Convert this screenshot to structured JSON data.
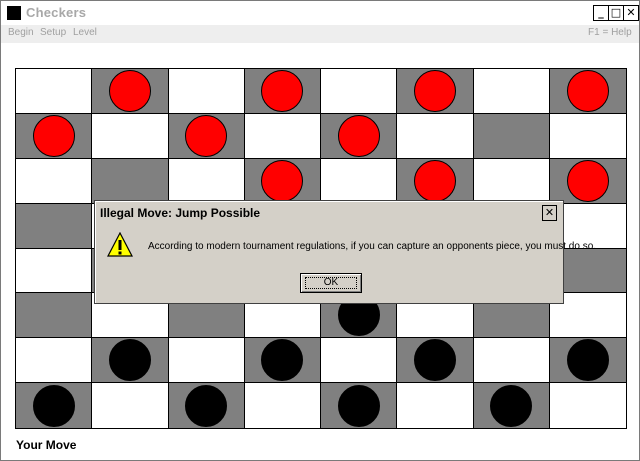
{
  "window": {
    "title": "Checkers",
    "minimize_glyph": "_",
    "maximize_glyph": "□",
    "close_glyph": "✕",
    "icon": "app-icon"
  },
  "menu": {
    "items": [
      "Begin",
      "Setup",
      "Level"
    ],
    "help": "F1 = Help"
  },
  "board": {
    "colors": {
      "light": "#ffffff",
      "dark": "#808080",
      "red": "#ff0000",
      "black": "#000000"
    },
    "rows": [
      [
        "",
        "R",
        "",
        "R",
        "",
        "R",
        "",
        "R"
      ],
      [
        "R",
        "",
        "R",
        "",
        "R",
        "",
        "",
        ""
      ],
      [
        "",
        "",
        "",
        "R",
        "",
        "R",
        "",
        "R"
      ],
      [
        "",
        "",
        "",
        "",
        "",
        "",
        "",
        ""
      ],
      [
        "",
        "",
        "",
        "",
        "",
        "",
        "",
        ""
      ],
      [
        "",
        "",
        "",
        "",
        "B",
        "",
        "",
        ""
      ],
      [
        "",
        "B",
        "",
        "B",
        "",
        "B",
        "",
        "B"
      ],
      [
        "B",
        "",
        "B",
        "",
        "B",
        "",
        "B",
        ""
      ]
    ]
  },
  "status": "Your Move",
  "dialog": {
    "title": "Illegal Move: Jump Possible",
    "message": "According to modern tournament regulations, if you can capture an opponents piece, you must do so.",
    "ok_label": "OK",
    "close_glyph": "✕",
    "icon": "warning-icon"
  }
}
